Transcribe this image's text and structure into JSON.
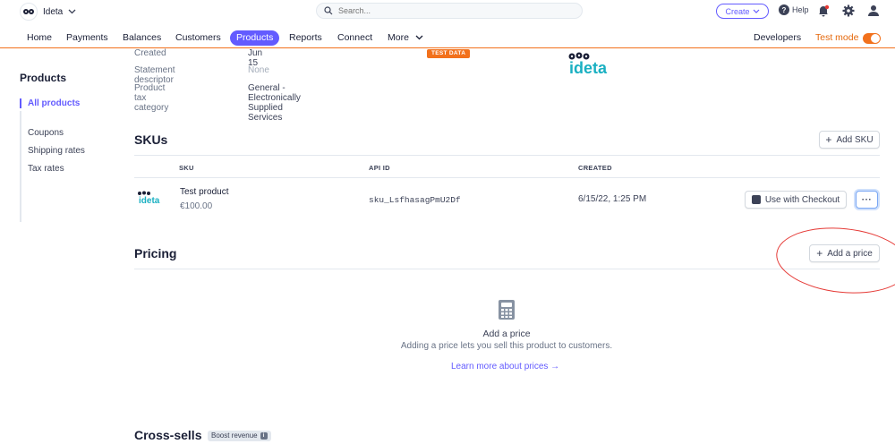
{
  "topbar": {
    "account_name": "Ideta",
    "search_placeholder": "Search...",
    "create_label": "Create",
    "help_label": "Help"
  },
  "nav": {
    "items": [
      "Home",
      "Payments",
      "Balances",
      "Customers",
      "Products",
      "Reports",
      "Connect",
      "More"
    ],
    "active": "Products",
    "developers": "Developers",
    "test_mode": "Test mode"
  },
  "sidebar": {
    "title": "Products",
    "items": [
      "All products",
      "Coupons",
      "Shipping rates",
      "Tax rates"
    ]
  },
  "details": {
    "rows": [
      {
        "label": "Created",
        "value": "Jun 15"
      },
      {
        "label": "Statement descriptor",
        "value": "None"
      },
      {
        "label": "Product tax category",
        "value": "General - Electronically Supplied Services"
      }
    ],
    "badge": "TEST DATA",
    "logo_text": "ideta"
  },
  "skus": {
    "title": "SKUs",
    "add_label": "Add SKU",
    "columns": [
      "SKU",
      "API ID",
      "CREATED"
    ],
    "rows": [
      {
        "logo_text": "ideta",
        "name": "Test product",
        "price": "€100.00",
        "api_id": "sku_LsfhasagPmU2Df",
        "created": "6/15/22, 1:25 PM",
        "action": "Use with Checkout"
      }
    ]
  },
  "pricing": {
    "title": "Pricing",
    "add_label": "Add a price",
    "empty_title": "Add a price",
    "empty_desc": "Adding a price lets you sell this product to customers.",
    "learn_more": "Learn more about prices →"
  },
  "crosssells": {
    "title": "Cross-sells",
    "badge": "Boost revenue"
  },
  "colors": {
    "accent": "#635bff",
    "test_mode": "#f2711c",
    "annotation": "#e53935"
  }
}
